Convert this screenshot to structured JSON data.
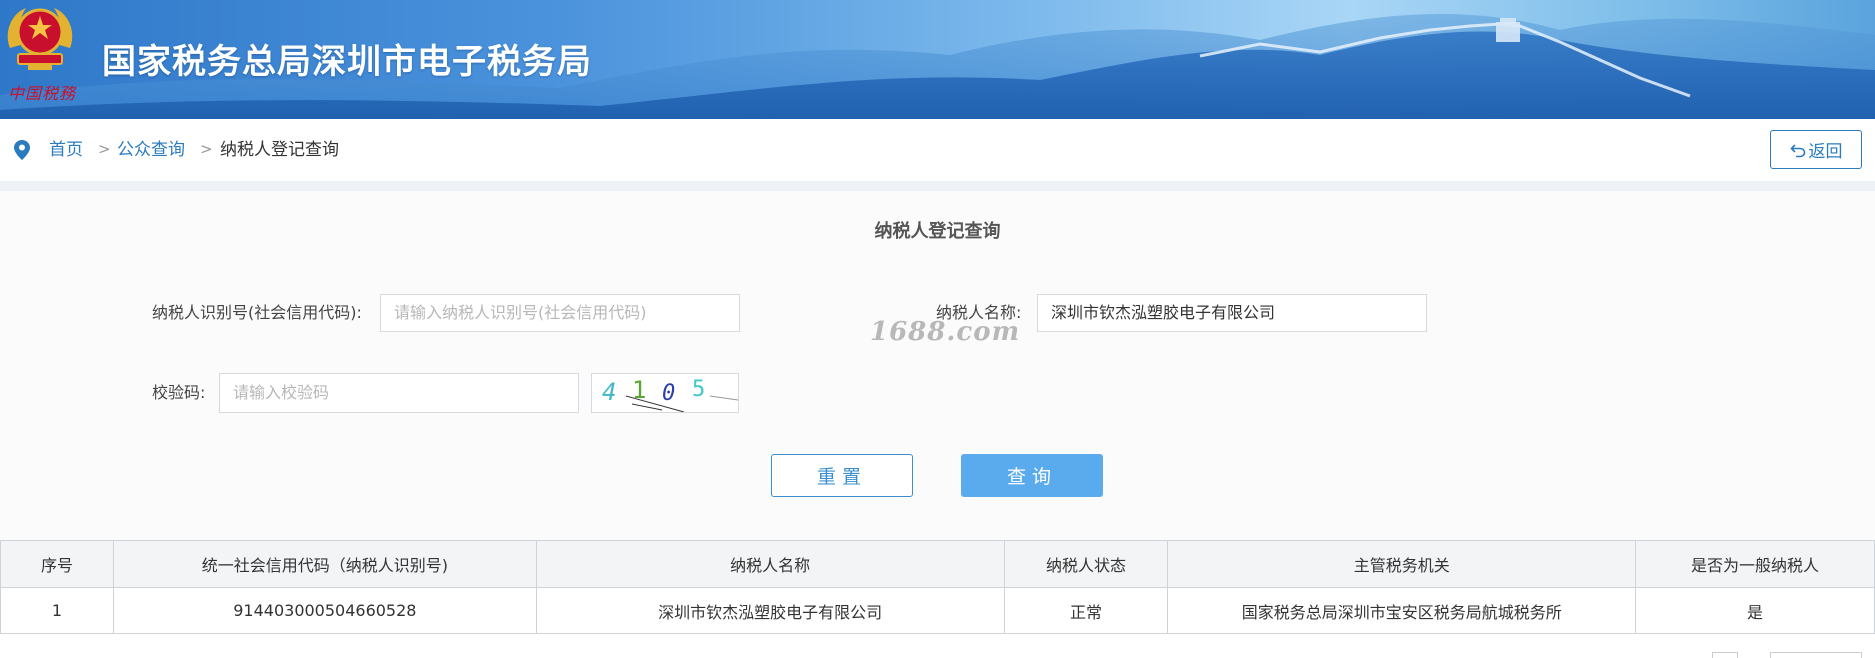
{
  "header": {
    "site_title": "国家税务总局深圳市电子税务局",
    "signature": "中国税務",
    "colors": {
      "banner_dark": "#2f78c9",
      "banner_light": "#a9d6f6",
      "emblem_red": "#c8102e",
      "emblem_gold": "#e3b231"
    }
  },
  "breadcrumb": {
    "icon": "location-pin-icon",
    "items": [
      {
        "label": "首页",
        "link": true
      },
      {
        "label": "公众查询",
        "link": true
      },
      {
        "label": "纳税人登记查询",
        "link": false
      }
    ],
    "separator": ">",
    "back_icon": "undo-icon",
    "back_label": "返回"
  },
  "form": {
    "title": "纳税人登记查询",
    "taxpayer_id": {
      "label": "纳税人识别号(社会信用代码):",
      "placeholder": "请输入纳税人识别号(社会信用代码)",
      "value": ""
    },
    "taxpayer_name": {
      "label": "纳税人名称:",
      "value": "深圳市钦杰泓塑胶电子有限公司"
    },
    "captcha": {
      "label": "校验码:",
      "placeholder": "请输入校验码",
      "value": "",
      "image_text": "4105"
    },
    "watermark": "1688.com",
    "reset_label": "重置",
    "query_label": "查询",
    "colors": {
      "accent": "#2a7bbf",
      "query_bg": "#5aaaee",
      "reset_border": "#3c8fce"
    }
  },
  "results": {
    "columns": [
      "序号",
      "统一社会信用代码（纳税人识别号)",
      "纳税人名称",
      "纳税人状态",
      "主管税务机关",
      "是否为一般纳税人"
    ],
    "rows": [
      [
        "1",
        "914403000504660528",
        "深圳市钦杰泓塑胶电子有限公司",
        "正常",
        "国家税务总局深圳市宝安区税务局航城税务所",
        "是"
      ]
    ]
  }
}
